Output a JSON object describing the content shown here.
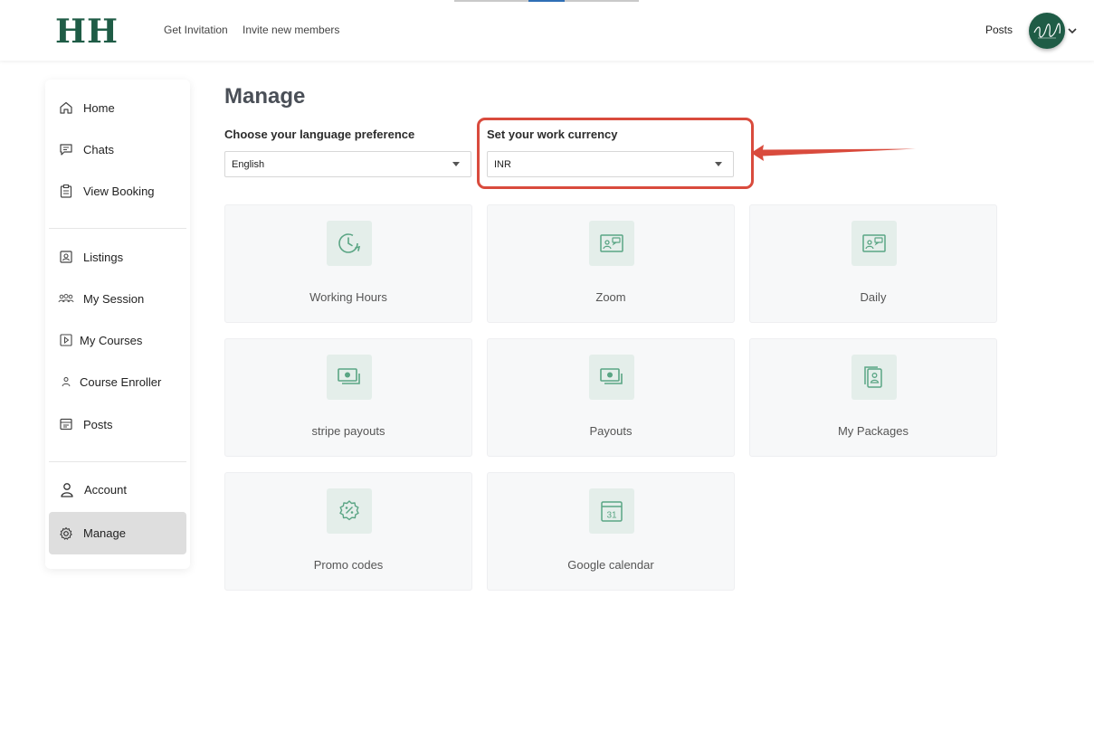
{
  "header": {
    "logo": "HH",
    "nav": [
      "Get Invitation",
      "Invite new members"
    ],
    "posts_label": "Posts",
    "avatar_icon": "avatar-signature",
    "brand_color": "#1f5c46"
  },
  "sidebar": {
    "groups": [
      [
        {
          "label": "Home",
          "icon": "home-icon"
        },
        {
          "label": "Chats",
          "icon": "chat-icon"
        },
        {
          "label": "View Booking",
          "icon": "clipboard-icon"
        }
      ],
      [
        {
          "label": "Listings",
          "icon": "listing-icon"
        },
        {
          "label": "My Session",
          "icon": "group-icon"
        },
        {
          "label": "My Courses",
          "icon": "play-icon"
        },
        {
          "label": "Course Enroller",
          "icon": "user-icon"
        },
        {
          "label": "Posts",
          "icon": "browser-icon"
        }
      ],
      [
        {
          "label": "Account",
          "icon": "person-icon"
        },
        {
          "label": "Manage",
          "icon": "gear-icon",
          "active": true
        }
      ]
    ]
  },
  "main": {
    "title": "Manage",
    "language": {
      "label": "Choose your language preference",
      "value": "English"
    },
    "currency": {
      "label": "Set your work currency",
      "value": "INR"
    },
    "cards": [
      {
        "label": "Working Hours",
        "icon": "clock-icon"
      },
      {
        "label": "Zoom",
        "icon": "contact-card-icon"
      },
      {
        "label": "Daily",
        "icon": "contact-card-icon"
      },
      {
        "label": "stripe payouts",
        "icon": "money-icon"
      },
      {
        "label": "Payouts",
        "icon": "money-icon"
      },
      {
        "label": "My Packages",
        "icon": "package-icon"
      },
      {
        "label": "Promo codes",
        "icon": "promo-badge-icon"
      },
      {
        "label": "Google calendar",
        "icon": "calendar-icon"
      }
    ]
  },
  "colors": {
    "accent": "#5aa584",
    "highlight": "#d94b3d",
    "card_bg": "#f7f8f9",
    "icon_bg": "#e4eeea"
  }
}
